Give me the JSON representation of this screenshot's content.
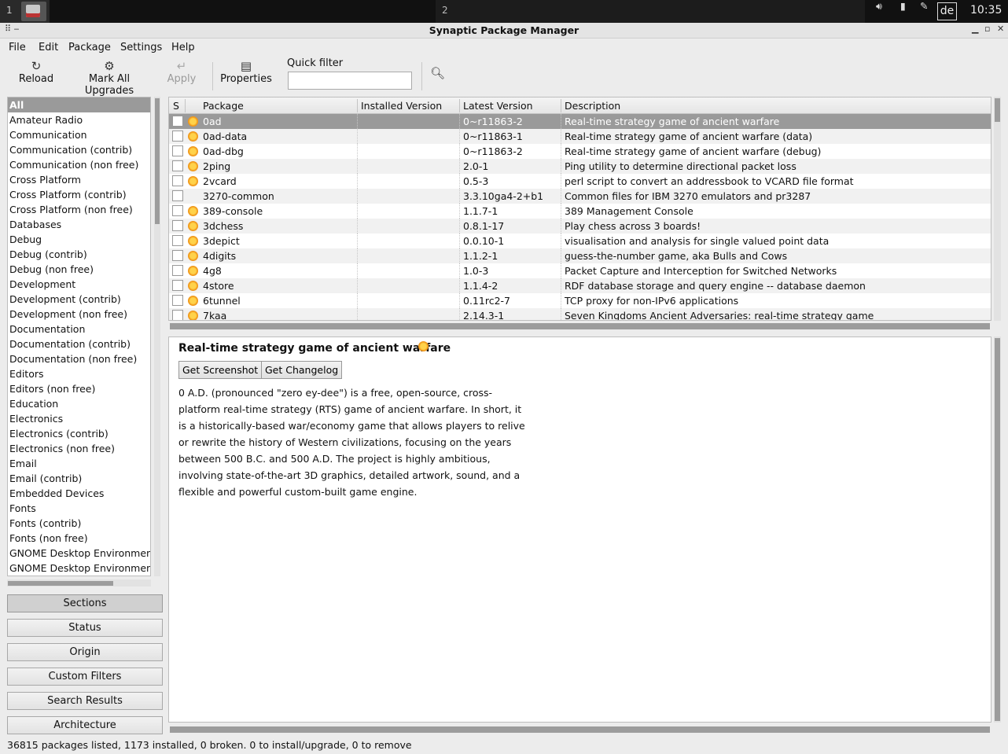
{
  "desktop": {
    "workspace_1": "1",
    "workspace_2": "2",
    "keyboard_layout": "de",
    "clock": "10:35"
  },
  "window": {
    "title": "Synaptic Package Manager"
  },
  "menu": {
    "file": "File",
    "edit": "Edit",
    "package": "Package",
    "settings": "Settings",
    "help": "Help"
  },
  "toolbar": {
    "reload": "Reload",
    "mark_all_upgrades": "Mark All Upgrades",
    "apply": "Apply",
    "properties": "Properties",
    "quick_filter_label": "Quick filter",
    "quick_filter_value": ""
  },
  "sections": [
    "All",
    "Amateur Radio",
    "Communication",
    "Communication (contrib)",
    "Communication (non free)",
    "Cross Platform",
    "Cross Platform (contrib)",
    "Cross Platform (non free)",
    "Databases",
    "Debug",
    "Debug (contrib)",
    "Debug (non free)",
    "Development",
    "Development (contrib)",
    "Development (non free)",
    "Documentation",
    "Documentation (contrib)",
    "Documentation (non free)",
    "Editors",
    "Editors (non free)",
    "Education",
    "Electronics",
    "Electronics (contrib)",
    "Electronics (non free)",
    "Email",
    "Email (contrib)",
    "Embedded Devices",
    "Fonts",
    "Fonts (contrib)",
    "Fonts (non free)",
    "GNOME Desktop Environment",
    "GNOME Desktop Environment"
  ],
  "filter_buttons": {
    "sections": "Sections",
    "status": "Status",
    "origin": "Origin",
    "custom_filters": "Custom Filters",
    "search_results": "Search Results",
    "architecture": "Architecture"
  },
  "columns": {
    "s": "S",
    "package": "Package",
    "installed_version": "Installed Version",
    "latest_version": "Latest Version",
    "description": "Description"
  },
  "packages": [
    {
      "name": "0ad",
      "installed": "",
      "latest": "0~r11863-2",
      "description": "Real-time strategy game of ancient warfare",
      "supported": true
    },
    {
      "name": "0ad-data",
      "installed": "",
      "latest": "0~r11863-1",
      "description": "Real-time strategy game of ancient warfare (data)",
      "supported": true
    },
    {
      "name": "0ad-dbg",
      "installed": "",
      "latest": "0~r11863-2",
      "description": "Real-time strategy game of ancient warfare (debug)",
      "supported": true
    },
    {
      "name": "2ping",
      "installed": "",
      "latest": "2.0-1",
      "description": "Ping utility to determine directional packet loss",
      "supported": true
    },
    {
      "name": "2vcard",
      "installed": "",
      "latest": "0.5-3",
      "description": "perl script to convert an addressbook to VCARD file format",
      "supported": true
    },
    {
      "name": "3270-common",
      "installed": "",
      "latest": "3.3.10ga4-2+b1",
      "description": "Common files for IBM 3270 emulators and pr3287",
      "supported": false
    },
    {
      "name": "389-console",
      "installed": "",
      "latest": "1.1.7-1",
      "description": "389 Management Console",
      "supported": true
    },
    {
      "name": "3dchess",
      "installed": "",
      "latest": "0.8.1-17",
      "description": "Play chess across 3 boards!",
      "supported": true
    },
    {
      "name": "3depict",
      "installed": "",
      "latest": "0.0.10-1",
      "description": "visualisation and analysis for single valued point data",
      "supported": true
    },
    {
      "name": "4digits",
      "installed": "",
      "latest": "1.1.2-1",
      "description": "guess-the-number game, aka Bulls and Cows",
      "supported": true
    },
    {
      "name": "4g8",
      "installed": "",
      "latest": "1.0-3",
      "description": "Packet Capture and Interception for Switched Networks",
      "supported": true
    },
    {
      "name": "4store",
      "installed": "",
      "latest": "1.1.4-2",
      "description": "RDF database storage and query engine -- database daemon",
      "supported": true
    },
    {
      "name": "6tunnel",
      "installed": "",
      "latest": "0.11rc2-7",
      "description": "TCP proxy for non-IPv6 applications",
      "supported": true
    },
    {
      "name": "7kaa",
      "installed": "",
      "latest": "2.14.3-1",
      "description": "Seven Kingdoms Ancient Adversaries: real-time strategy game",
      "supported": true
    }
  ],
  "details": {
    "title": "Real-time strategy game of ancient warfare",
    "get_screenshot": "Get Screenshot",
    "get_changelog": "Get Changelog",
    "text": "0 A.D. (pronounced \"zero ey-dee\") is a free, open-source, cross-platform real-time strategy (RTS) game of ancient warfare. In short, it is a historically-based war/economy game that allows players to relive or rewrite the history of Western civilizations, focusing on the years between 500 B.C. and 500 A.D. The project is highly ambitious, involving state-of-the-art 3D graphics, detailed artwork, sound, and a flexible and powerful custom-built game engine."
  },
  "status": "36815 packages listed, 1173 installed, 0 broken. 0 to install/upgrade, 0 to remove"
}
